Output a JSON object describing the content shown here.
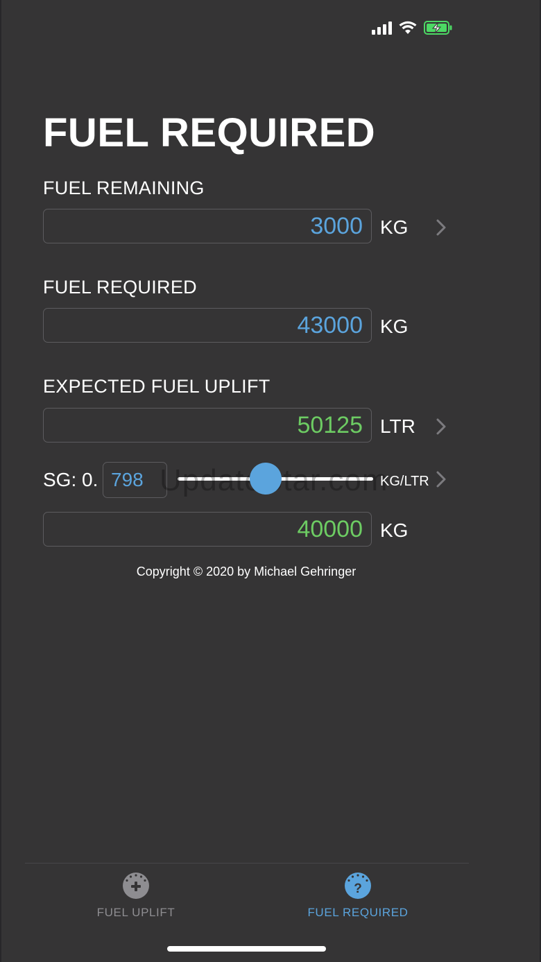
{
  "status_bar": {
    "signal_bars": 4,
    "wifi_icon": "wifi-icon",
    "battery_icon": "battery-charging-icon",
    "battery_color": "#4cd964"
  },
  "page": {
    "title": "FUEL REQUIRED"
  },
  "fuel_remaining": {
    "label": "FUEL REMAINING",
    "value": "3000",
    "unit": "KG",
    "value_color": "#5ba4dd"
  },
  "fuel_required": {
    "label": "FUEL REQUIRED",
    "value": "43000",
    "unit": "KG",
    "value_color": "#5ba4dd"
  },
  "expected_uplift": {
    "label": "EXPECTED FUEL UPLIFT",
    "value": "50125",
    "unit": "LTR",
    "value_color": "#6dcc63"
  },
  "sg": {
    "label": "SG: 0.",
    "value": "798",
    "unit": "KG/LTR",
    "slider_fraction": 0.45
  },
  "uplift_kg": {
    "value": "40000",
    "unit": "KG",
    "value_color": "#6dcc63"
  },
  "watermark": "UpdateStar.com",
  "copyright": "Copyright © 2020 by Michael Gehringer",
  "tabs": [
    {
      "label": "FUEL UPLIFT",
      "icon": "plus-gauge-icon",
      "active": false
    },
    {
      "label": "FUEL REQUIRED",
      "icon": "question-gauge-icon",
      "active": true
    }
  ],
  "colors": {
    "accent": "#5ba4dd",
    "computed": "#6dcc63",
    "background": "#353435"
  }
}
